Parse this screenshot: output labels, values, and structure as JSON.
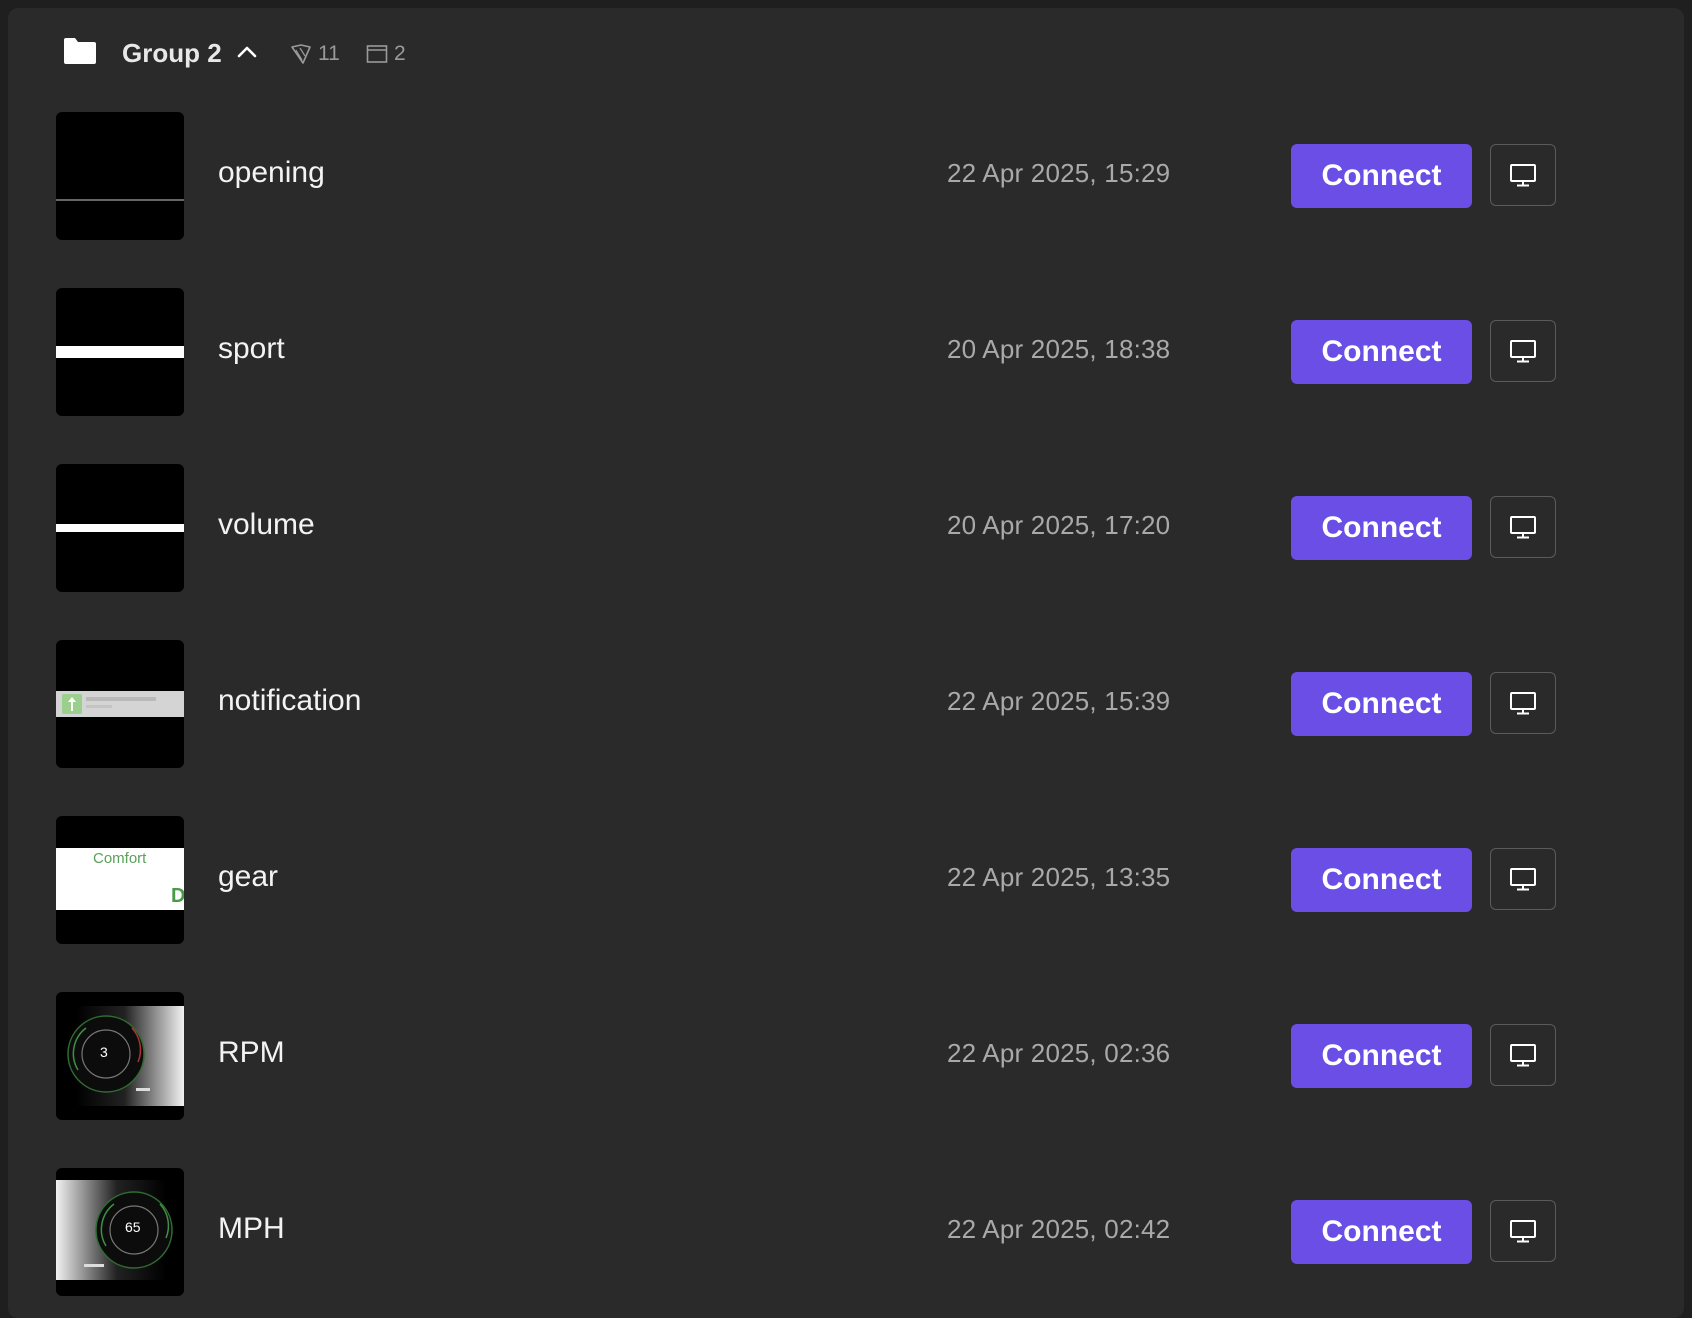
{
  "group": {
    "title": "Group 2",
    "tag_count": "11",
    "screen_count": "2"
  },
  "rows": [
    {
      "name": "opening",
      "date": "22 Apr 2025, 15:29",
      "connect_label": "Connect"
    },
    {
      "name": "sport",
      "date": "20 Apr 2025, 18:38",
      "connect_label": "Connect"
    },
    {
      "name": "volume",
      "date": "20 Apr 2025, 17:20",
      "connect_label": "Connect"
    },
    {
      "name": "notification",
      "date": "22 Apr 2025, 15:39",
      "connect_label": "Connect"
    },
    {
      "name": "gear",
      "date": "22 Apr 2025, 13:35",
      "connect_label": "Connect"
    },
    {
      "name": "RPM",
      "date": "22 Apr 2025, 02:36",
      "connect_label": "Connect"
    },
    {
      "name": "MPH",
      "date": "22 Apr 2025, 02:42",
      "connect_label": "Connect"
    }
  ],
  "thumbnails": {
    "gear_label": "Comfort",
    "gear_letter": "D",
    "rpm_value": "3",
    "mph_value": "65"
  },
  "icons": {
    "folder": "folder-icon",
    "collapse": "chevron-up-icon",
    "tags": "tag-icon",
    "screens": "window-icon",
    "display": "monitor-icon"
  },
  "colors": {
    "accent": "#6a4ee6",
    "background": "#2a2a2a",
    "muted_text": "#a9a9a9"
  }
}
